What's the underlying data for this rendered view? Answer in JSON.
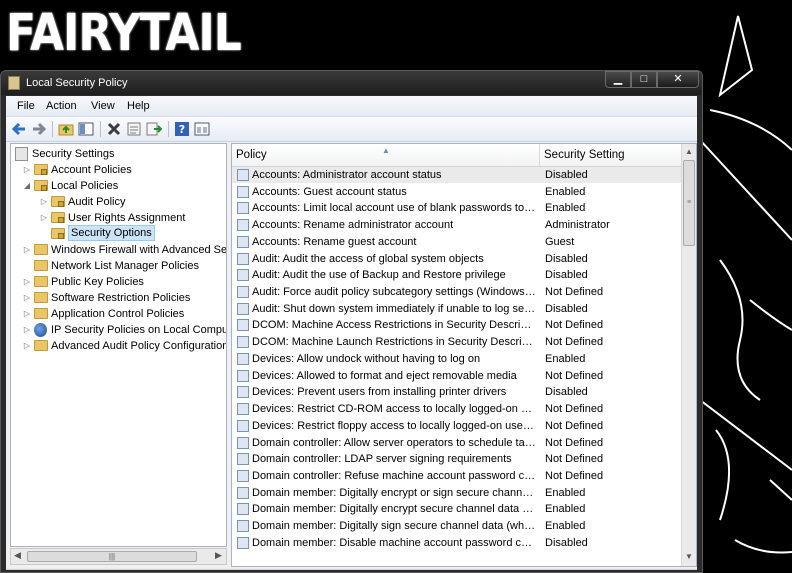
{
  "wallpaper": {
    "logo_text": "FAIRYTAIL"
  },
  "window": {
    "title": "Local Security Policy",
    "controls": {
      "minimize": "▁",
      "maximize": "□",
      "close": "✕"
    }
  },
  "menu": [
    "File",
    "Action",
    "View",
    "Help"
  ],
  "toolbar": {
    "icons": [
      "back-icon",
      "forward-icon",
      "up-folder-icon",
      "show-hide-tree-icon",
      "delete-icon",
      "properties-icon",
      "export-list-icon",
      "help-icon",
      "console-view-icon"
    ]
  },
  "tree": {
    "items": [
      {
        "label": "Security Settings",
        "level": 0,
        "arrow": "",
        "icon": "settings"
      },
      {
        "label": "Account Policies",
        "level": 1,
        "arrow": "▷",
        "icon": "folder-lock"
      },
      {
        "label": "Local Policies",
        "level": 1,
        "arrow": "◢",
        "icon": "folder-lock"
      },
      {
        "label": "Audit Policy",
        "level": 2,
        "arrow": "▷",
        "icon": "folder-lock"
      },
      {
        "label": "User Rights Assignment",
        "level": 2,
        "arrow": "▷",
        "icon": "folder-lock"
      },
      {
        "label": "Security Options",
        "level": 2,
        "arrow": "",
        "icon": "folder-lock",
        "selected": true
      },
      {
        "label": "Windows Firewall with Advanced Secu",
        "level": 1,
        "arrow": "▷",
        "icon": "folder"
      },
      {
        "label": "Network List Manager Policies",
        "level": 1,
        "arrow": "",
        "icon": "folder"
      },
      {
        "label": "Public Key Policies",
        "level": 1,
        "arrow": "▷",
        "icon": "folder"
      },
      {
        "label": "Software Restriction Policies",
        "level": 1,
        "arrow": "▷",
        "icon": "folder"
      },
      {
        "label": "Application Control Policies",
        "level": 1,
        "arrow": "▷",
        "icon": "folder"
      },
      {
        "label": "IP Security Policies on Local Compute",
        "level": 1,
        "arrow": "▷",
        "icon": "network"
      },
      {
        "label": "Advanced Audit Policy Configuration",
        "level": 1,
        "arrow": "▷",
        "icon": "folder"
      }
    ],
    "hscroll_grip": "|||"
  },
  "list": {
    "columns": {
      "policy": "Policy",
      "setting": "Security Setting"
    },
    "rows": [
      {
        "policy": "Accounts: Administrator account status",
        "setting": "Disabled"
      },
      {
        "policy": "Accounts: Guest account status",
        "setting": "Enabled"
      },
      {
        "policy": "Accounts: Limit local account use of blank passwords to co...",
        "setting": "Enabled"
      },
      {
        "policy": "Accounts: Rename administrator account",
        "setting": "Administrator"
      },
      {
        "policy": "Accounts: Rename guest account",
        "setting": "Guest"
      },
      {
        "policy": "Audit: Audit the access of global system objects",
        "setting": "Disabled"
      },
      {
        "policy": "Audit: Audit the use of Backup and Restore privilege",
        "setting": "Disabled"
      },
      {
        "policy": "Audit: Force audit policy subcategory settings (Windows Vis...",
        "setting": "Not Defined"
      },
      {
        "policy": "Audit: Shut down system immediately if unable to log secur...",
        "setting": "Disabled"
      },
      {
        "policy": "DCOM: Machine Access Restrictions in Security Descriptor D...",
        "setting": "Not Defined"
      },
      {
        "policy": "DCOM: Machine Launch Restrictions in Security Descriptor ...",
        "setting": "Not Defined"
      },
      {
        "policy": "Devices: Allow undock without having to log on",
        "setting": "Enabled"
      },
      {
        "policy": "Devices: Allowed to format and eject removable media",
        "setting": "Not Defined"
      },
      {
        "policy": "Devices: Prevent users from installing printer drivers",
        "setting": "Disabled"
      },
      {
        "policy": "Devices: Restrict CD-ROM access to locally logged-on user ...",
        "setting": "Not Defined"
      },
      {
        "policy": "Devices: Restrict floppy access to locally logged-on user only",
        "setting": "Not Defined"
      },
      {
        "policy": "Domain controller: Allow server operators to schedule tasks",
        "setting": "Not Defined"
      },
      {
        "policy": "Domain controller: LDAP server signing requirements",
        "setting": "Not Defined"
      },
      {
        "policy": "Domain controller: Refuse machine account password chan...",
        "setting": "Not Defined"
      },
      {
        "policy": "Domain member: Digitally encrypt or sign secure channel d...",
        "setting": "Enabled"
      },
      {
        "policy": "Domain member: Digitally encrypt secure channel data (wh...",
        "setting": "Enabled"
      },
      {
        "policy": "Domain member: Digitally sign secure channel data (when ...",
        "setting": "Enabled"
      },
      {
        "policy": "Domain member: Disable machine account password chan...",
        "setting": "Disabled"
      }
    ],
    "vscroll_grip": "≡"
  }
}
